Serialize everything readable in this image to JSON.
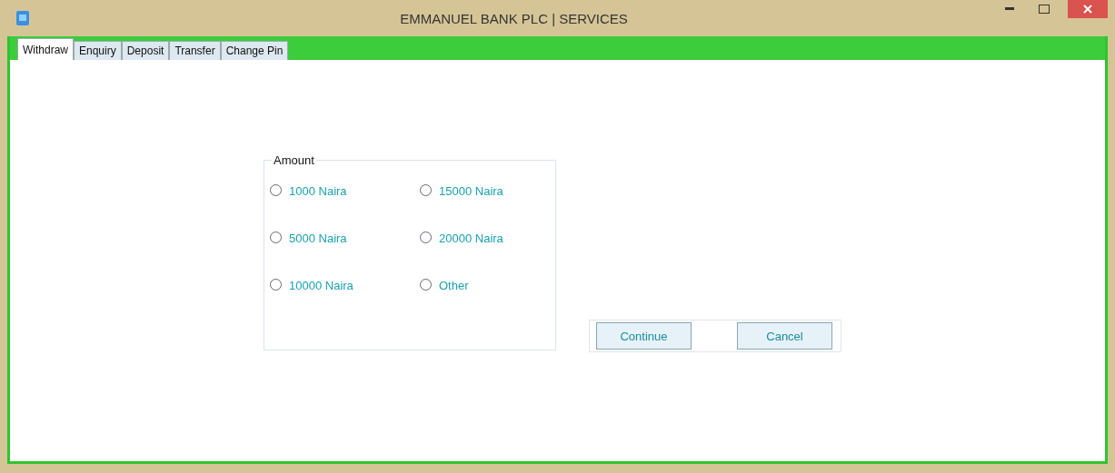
{
  "window": {
    "title": "EMMANUEL BANK PLC | SERVICES"
  },
  "tabs": [
    {
      "label": "Withdraw",
      "selected": true
    },
    {
      "label": "Enquiry",
      "selected": false
    },
    {
      "label": "Deposit",
      "selected": false
    },
    {
      "label": "Transfer",
      "selected": false
    },
    {
      "label": "Change Pin",
      "selected": false
    }
  ],
  "amount_group": {
    "title": "Amount",
    "options": [
      {
        "label": "1000 Naira",
        "selected": false
      },
      {
        "label": "15000 Naira",
        "selected": false
      },
      {
        "label": "5000 Naira",
        "selected": false
      },
      {
        "label": "20000 Naira",
        "selected": false
      },
      {
        "label": "10000 Naira",
        "selected": false
      },
      {
        "label": "Other",
        "selected": false
      }
    ]
  },
  "buttons": [
    "Continue",
    "Cancel"
  ]
}
